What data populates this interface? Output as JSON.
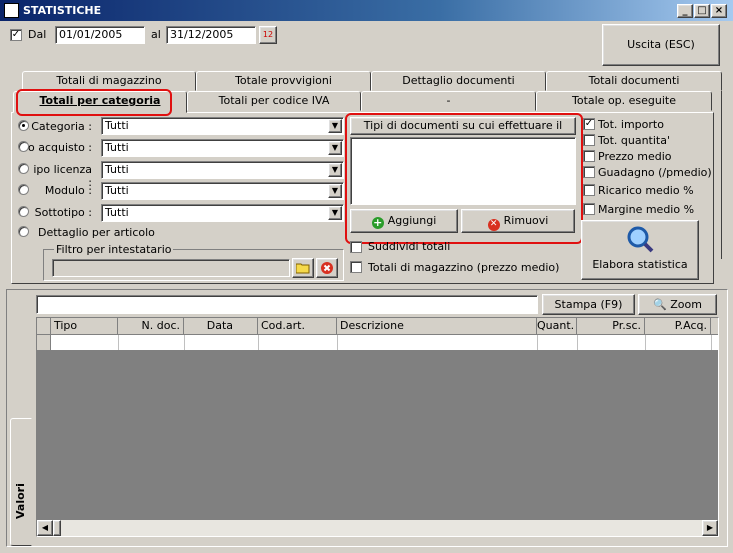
{
  "window": {
    "title": "STATISTICHE"
  },
  "dates": {
    "dal_label": "Dal",
    "from": "01/01/2005",
    "al_label": "al",
    "to": "31/12/2005",
    "calendar_glyph": "12"
  },
  "exit_button": "Uscita (ESC)",
  "tabs_row1": [
    "Totali di magazzino",
    "Totale provvigioni",
    "Dettaglio documenti",
    "Totali documenti"
  ],
  "tabs_row2": [
    "Totali per categoria",
    "Totali per codice IVA",
    "-",
    "Totale op. eseguite"
  ],
  "filters": [
    {
      "label": "Categoria :",
      "value": "Tutti"
    },
    {
      "label": "o acquisto :",
      "value": "Tutti"
    },
    {
      "label": "ipo licenza :",
      "value": "Tutti"
    },
    {
      "label": "Modulo :",
      "value": "Tutti"
    },
    {
      "label": "Sottotipo :",
      "value": "Tutti"
    }
  ],
  "detail_label": "Dettaglio per articolo",
  "owner_filter": {
    "legend": "Filtro per intestatario",
    "value": ""
  },
  "doc_types": {
    "header": "Tipi di documenti su cui effettuare il calcolo",
    "add": "Aggiungi",
    "remove": "Rimuovi"
  },
  "options": {
    "split": "Suddividi totali",
    "warehouse_totals": "Totali di magazzino (prezzo medio)"
  },
  "checks": [
    "Tot. importo",
    "Tot. quantita'",
    "Prezzo medio",
    "Guadagno (/pmedio)",
    "Ricarico medio %",
    "Margine medio %"
  ],
  "checks_state": [
    true,
    false,
    false,
    false,
    false,
    false
  ],
  "elabora": "Elabora statistica",
  "side_tab": "Valori",
  "grid": {
    "search_value": "",
    "print": "Stampa (F9)",
    "zoom": "Zoom",
    "columns": [
      "Tipo",
      "N. doc.",
      "Data",
      "Cod.art.",
      "Descrizione",
      "Quant.",
      "Pr.sc.",
      "P.Acq."
    ]
  }
}
